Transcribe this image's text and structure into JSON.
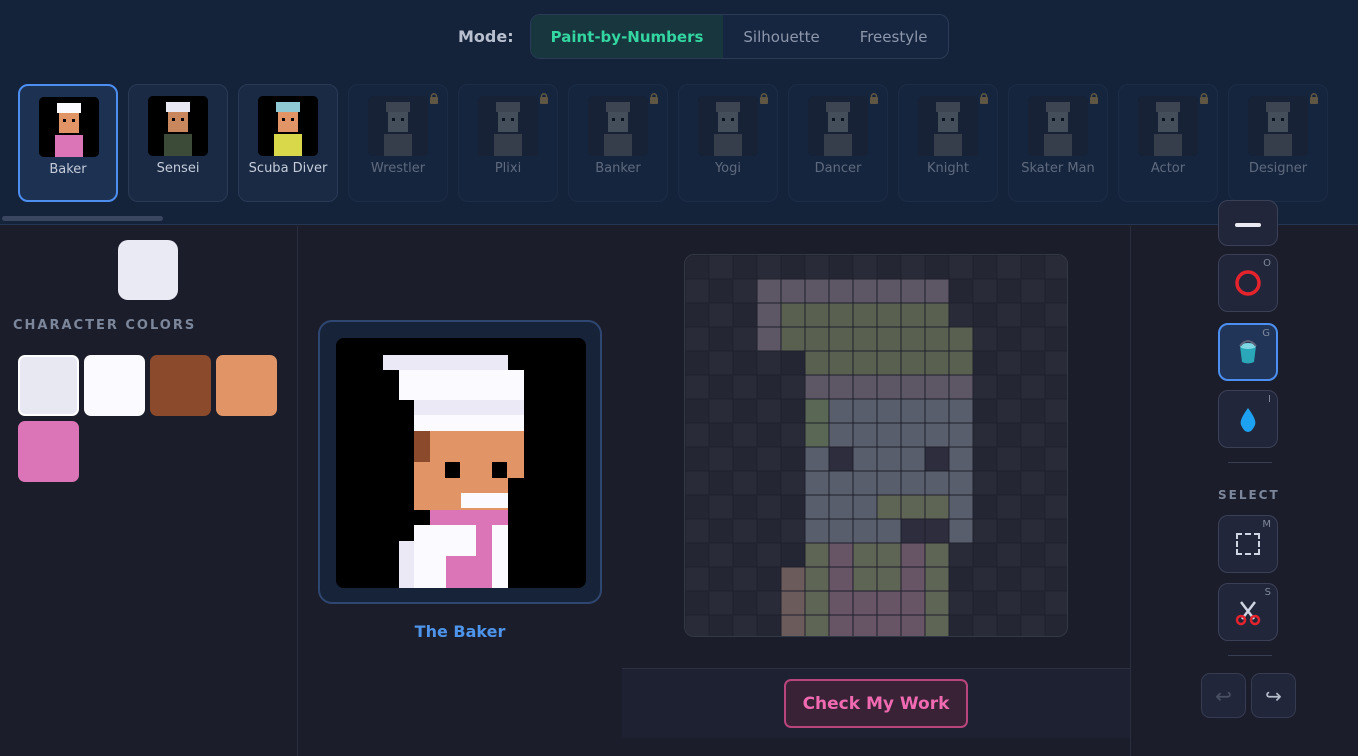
{
  "mode": {
    "label": "Mode:",
    "options": [
      "Paint-by-Numbers",
      "Silhouette",
      "Freestyle"
    ],
    "selected": "Paint-by-Numbers"
  },
  "characters": [
    {
      "name": "Baker",
      "selected": true,
      "locked": false
    },
    {
      "name": "Sensei",
      "selected": false,
      "locked": false
    },
    {
      "name": "Scuba Diver",
      "selected": false,
      "locked": false
    },
    {
      "name": "Wrestler",
      "selected": false,
      "locked": true
    },
    {
      "name": "Plixi",
      "selected": false,
      "locked": true
    },
    {
      "name": "Banker",
      "selected": false,
      "locked": true
    },
    {
      "name": "Yogi",
      "selected": false,
      "locked": true
    },
    {
      "name": "Dancer",
      "selected": false,
      "locked": true
    },
    {
      "name": "Knight",
      "selected": false,
      "locked": true
    },
    {
      "name": "Skater Man",
      "selected": false,
      "locked": true
    },
    {
      "name": "Actor",
      "selected": false,
      "locked": true
    },
    {
      "name": "Designer",
      "selected": false,
      "locked": true
    }
  ],
  "current_color": "#eaeaf4",
  "palette": {
    "title": "CHARACTER COLORS",
    "colors": [
      "#e8e8f3",
      "#fbfbff",
      "#8b4a2c",
      "#e19466",
      "#dc74b8"
    ]
  },
  "reference": {
    "name": "The Baker"
  },
  "tools": [
    {
      "name": "circle",
      "icon": "circle-icon",
      "key": "O",
      "active": false
    },
    {
      "name": "fill",
      "icon": "bucket-icon",
      "key": "G",
      "active": true
    },
    {
      "name": "eyedropper",
      "icon": "droplet-icon",
      "key": "I",
      "active": false
    }
  ],
  "select": {
    "title": "SELECT",
    "tools": [
      {
        "name": "marquee",
        "icon": "marquee-icon",
        "key": "M"
      },
      {
        "name": "cut",
        "icon": "scissors-icon",
        "key": "S"
      }
    ]
  },
  "actions": {
    "check": "Check My Work",
    "undo_icon": "undo-icon",
    "redo_icon": "redo-icon"
  },
  "colors": {
    "accent": "#33d6a0",
    "selection": "#4c8ff0",
    "check": "#ef6ab0"
  }
}
